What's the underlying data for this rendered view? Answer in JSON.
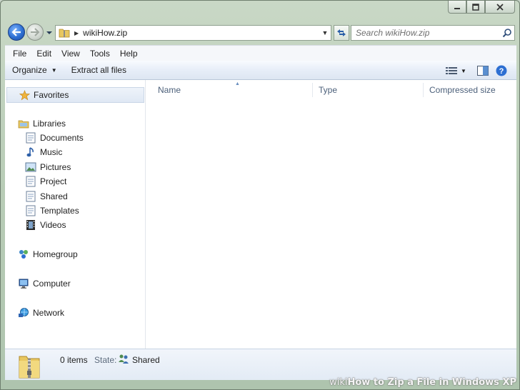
{
  "window": {
    "caption_buttons": {
      "minimize": "▭",
      "maximize": "▢",
      "close": "✕"
    }
  },
  "address_bar": {
    "path": "wikiHow.zip",
    "search_placeholder": "Search wikiHow.zip"
  },
  "menu": {
    "items": [
      "File",
      "Edit",
      "View",
      "Tools",
      "Help"
    ]
  },
  "commandbar": {
    "organize": "Organize",
    "extract": "Extract all files"
  },
  "nav": {
    "favorites": "Favorites",
    "libraries": "Libraries",
    "library_items": [
      "Documents",
      "Music",
      "Pictures",
      "Project",
      "Shared",
      "Templates",
      "Videos"
    ],
    "homegroup": "Homegroup",
    "computer": "Computer",
    "network": "Network"
  },
  "columns": [
    "Name",
    "Type",
    "Compressed size"
  ],
  "details": {
    "count": "0 items",
    "state_label": "State:",
    "state_value": "Shared"
  },
  "watermark": {
    "wiki": "wiki",
    "text": "How to Zip a File in Windows XP"
  },
  "colors": {
    "accent_blue": "#2d6fd2",
    "folder_yellow": "#e8c760",
    "favorites_star": "#f0b43c"
  }
}
